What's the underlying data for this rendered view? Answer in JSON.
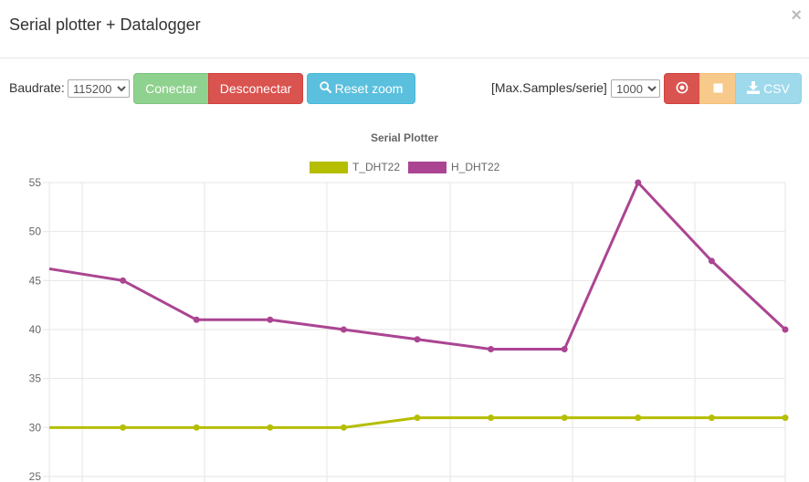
{
  "modal": {
    "title": "Serial plotter + Datalogger",
    "close_symbol": "×"
  },
  "toolbar": {
    "baud_label": "Baudrate:",
    "baud_value": "115200",
    "connect_label": "Conectar",
    "disconnect_label": "Desconectar",
    "reset_zoom_label": "Reset zoom",
    "max_samples_label": "[Max.Samples/serie]",
    "max_samples_value": "1000",
    "csv_label": "CSV"
  },
  "chart_data": {
    "type": "line",
    "title": "Serial Plotter",
    "ylim": [
      25,
      55
    ],
    "yticks": [
      25,
      30,
      35,
      40,
      45,
      50,
      55
    ],
    "grid": true,
    "legend_position": "top-center",
    "series": [
      {
        "name": "T_DHT22",
        "color": "#b5be00",
        "values": [
          30,
          30,
          30,
          30,
          30,
          31,
          31,
          31,
          31,
          31,
          31
        ]
      },
      {
        "name": "H_DHT22",
        "color": "#ab4592",
        "values": [
          46.2,
          45,
          41,
          41,
          40,
          39,
          38,
          38,
          55,
          47,
          40
        ]
      }
    ]
  }
}
